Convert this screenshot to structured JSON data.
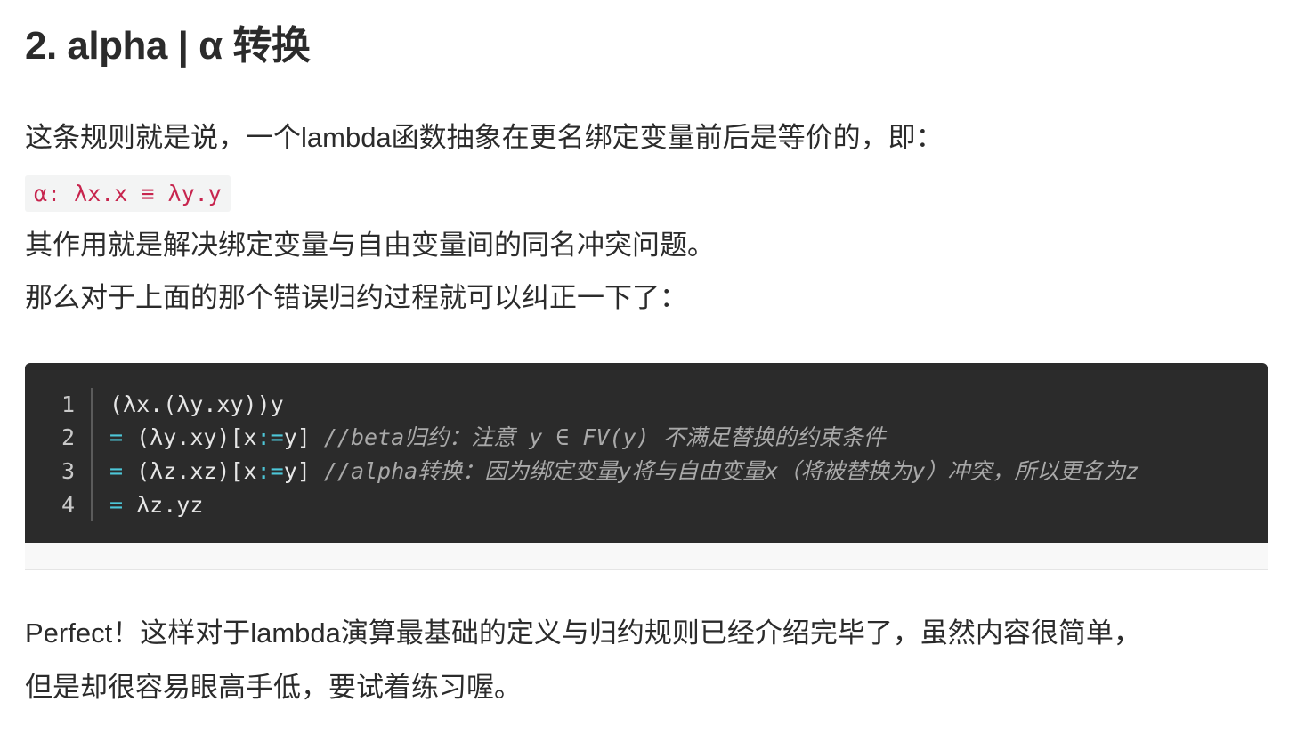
{
  "heading": "2. alpha | α 转换",
  "paragraphs": {
    "intro": "这条规则就是说，一个lambda函数抽象在更名绑定变量前后是等价的，即：",
    "purpose": "其作用就是解决绑定变量与自由变量间的同名冲突问题。",
    "transition": "那么对于上面的那个错误归约过程就可以纠正一下了：",
    "conclusion_line1": "Perfect！这样对于lambda演算最基础的定义与归约规则已经介绍完毕了，虽然内容很简单，",
    "conclusion_line2": "但是却很容易眼高手低，要试着练习喔。"
  },
  "inline_code": "α: λx.x ≡ λy.y",
  "code_block": {
    "line_numbers": [
      "1",
      "2",
      "3",
      "4"
    ],
    "lines": [
      {
        "code": "(λx.(λy.xy))y"
      },
      {
        "op": "=",
        "code": " (λy.xy)[x",
        "assign": ":=",
        "code_after": "y] ",
        "comment": "//beta归约：注意 y ∈ FV(y) 不满足替换的约束条件"
      },
      {
        "op": "=",
        "code": " (λz.xz)[x",
        "assign": ":=",
        "code_after": "y] ",
        "comment": "//alpha转换：因为绑定变量y将与自由变量x（将被替换为y）冲突，所以更名为z"
      },
      {
        "op": "=",
        "code": " λz.yz"
      }
    ]
  },
  "colors": {
    "text": "#2b2b2b",
    "inline_code_text": "#c7254e",
    "inline_code_bg": "#f3f4f4",
    "code_bg": "#2b2b2b",
    "code_text": "#e6e6e6",
    "code_operator": "#4dc7d8",
    "code_comment": "#a9a9a9"
  }
}
